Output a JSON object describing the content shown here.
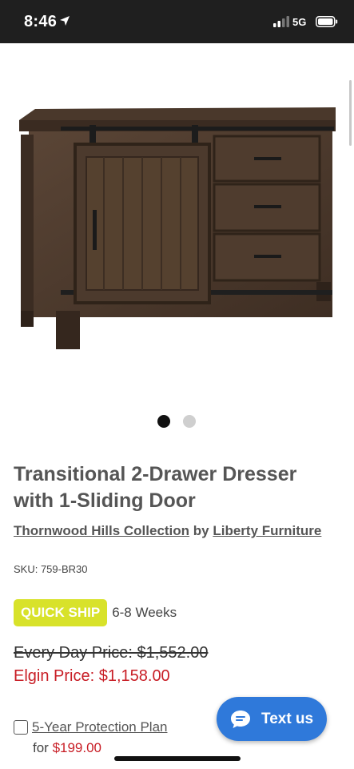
{
  "status_bar": {
    "time": "8:46",
    "network": "5G",
    "icons": [
      "location-arrow-icon",
      "signal-icon",
      "battery-icon"
    ]
  },
  "carousel": {
    "image_count": 2,
    "active_index": 0
  },
  "product": {
    "title": "Transitional 2-Drawer Dresser with 1-Sliding Door",
    "collection_link": "Thornwood Hills Collection",
    "by_text": " by ",
    "brand_link": "Liberty Furniture",
    "sku": "SKU: 759-BR30"
  },
  "shipping": {
    "badge": "QUICK SHIP",
    "lead_time": "6-8 Weeks"
  },
  "pricing": {
    "every_day": "Every Day Price: $1,552.00",
    "elgin": "Elgin Price: $1,158.00"
  },
  "protection": {
    "label": "5-Year Protection Plan",
    "for_text": "for ",
    "price": "$199.00",
    "checked": false
  },
  "chat_button": {
    "label": "Text us",
    "icon": "chat-bubble-icon"
  },
  "colors": {
    "status_bar_bg": "#1f1f1f",
    "accent_badge": "#d8e22a",
    "sale_red": "#c81d25",
    "chat_blue": "#2f79da"
  }
}
